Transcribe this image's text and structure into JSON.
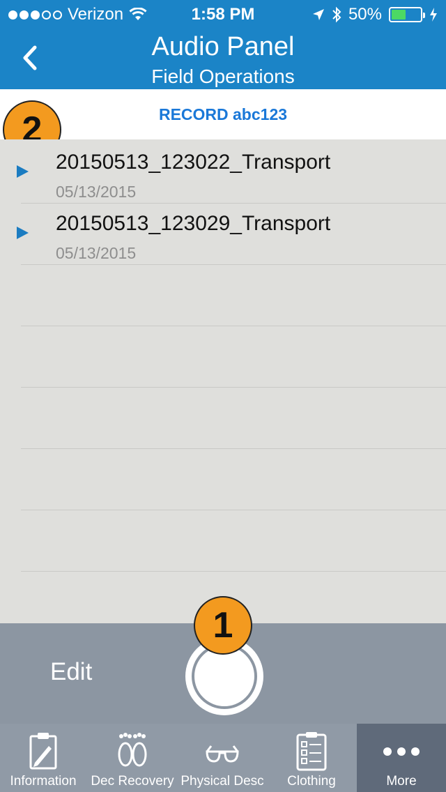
{
  "status_bar": {
    "carrier": "Verizon",
    "time": "1:58 PM",
    "battery": "50%",
    "battery_level": 0.5
  },
  "nav": {
    "title": "Audio Panel",
    "subtitle": "Field Operations"
  },
  "record_header": {
    "label": "RECORD abc123"
  },
  "badges": {
    "callout_1": "1",
    "callout_2": "2"
  },
  "recordings": [
    {
      "name": "20150513_123022_Transport",
      "date": "05/13/2015"
    },
    {
      "name": "20150513_123029_Transport",
      "date": "05/13/2015"
    }
  ],
  "toolbar": {
    "edit_label": "Edit"
  },
  "tabs": [
    {
      "label": "Information",
      "icon": "clipboard-pencil-icon"
    },
    {
      "label": "Dec Recovery",
      "icon": "footprints-icon"
    },
    {
      "label": "Physical Desc",
      "icon": "glasses-icon"
    },
    {
      "label": "Clothing",
      "icon": "checklist-icon"
    },
    {
      "label": "More",
      "icon": "more-dots-icon",
      "active": true
    }
  ],
  "colors": {
    "primary": "#1b84c7",
    "link": "#1a78d8",
    "badge": "#f39a1f",
    "toolbar": "#8c96a2",
    "active_tab": "#5f6a7a"
  }
}
